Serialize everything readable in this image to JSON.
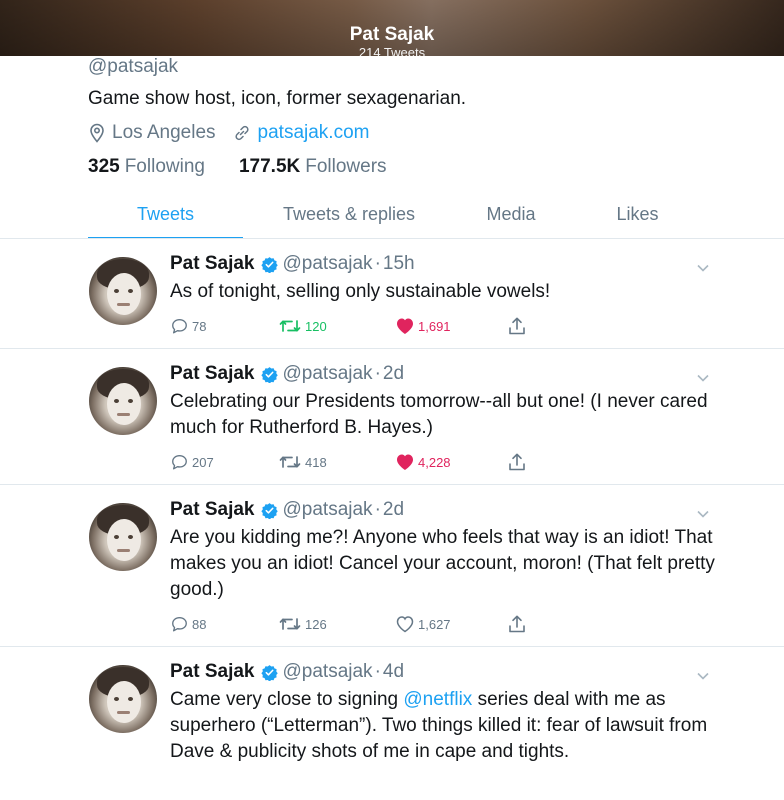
{
  "header": {
    "title": "Pat Sajak",
    "subtitle": "214 Tweets"
  },
  "profile": {
    "handle": "@patsajak",
    "bio": "Game show host, icon, former sexagenarian.",
    "location": "Los Angeles",
    "website": "patsajak.com",
    "following_count": "325",
    "following_label": "Following",
    "followers_count": "177.5K",
    "followers_label": "Followers"
  },
  "tabs": [
    {
      "label": "Tweets",
      "active": true
    },
    {
      "label": "Tweets & replies",
      "active": false
    },
    {
      "label": "Media",
      "active": false
    },
    {
      "label": "Likes",
      "active": false
    }
  ],
  "tweets": [
    {
      "name": "Pat Sajak",
      "handle": "@patsajak",
      "dot": "·",
      "time": "15h",
      "text": "As of tonight, selling only sustainable vowels!",
      "replies": "78",
      "retweets": "120",
      "likes": "1,691",
      "retweeted": true,
      "liked": true
    },
    {
      "name": "Pat Sajak",
      "handle": "@patsajak",
      "dot": "·",
      "time": "2d",
      "text": "Celebrating our Presidents tomorrow--all but one! (I never cared much for Rutherford B. Hayes.)",
      "replies": "207",
      "retweets": "418",
      "likes": "4,228",
      "retweeted": false,
      "liked": true
    },
    {
      "name": "Pat Sajak",
      "handle": "@patsajak",
      "dot": "·",
      "time": "2d",
      "text": "Are you kidding me?! Anyone who feels that way is an idiot! That makes you an idiot! Cancel your account, moron! (That felt pretty good.)",
      "replies": "88",
      "retweets": "126",
      "likes": "1,627",
      "retweeted": false,
      "liked": false
    },
    {
      "name": "Pat Sajak",
      "handle": "@patsajak",
      "dot": "·",
      "time": "4d",
      "text_before": "Came very close to signing ",
      "mention": "@netflix",
      "text_after": " series deal with me as superhero (“Letterman”). Two things killed it: fear of lawsuit from Dave & publicity shots of me in cape and tights.",
      "retweeted": false,
      "liked": false
    }
  ],
  "colors": {
    "accent": "#1da1f2",
    "retweet": "#17bf63",
    "like": "#e0245e",
    "muted": "#657786"
  }
}
